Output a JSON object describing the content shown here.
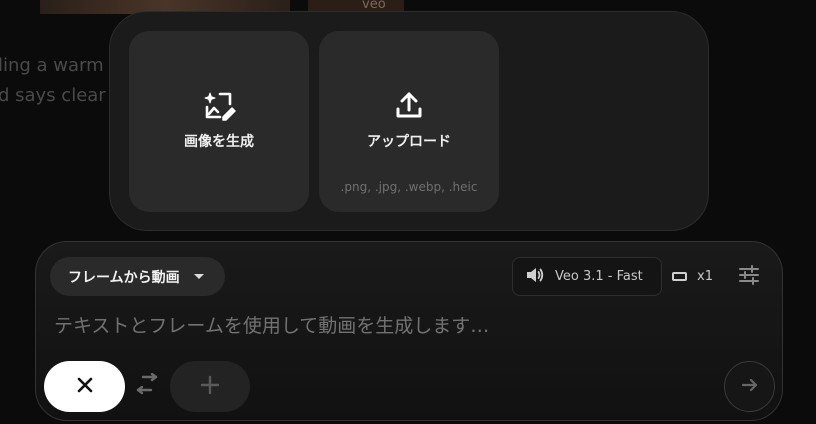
{
  "background": {
    "thumb_label": "veo",
    "text_line_1": "ling a warm c",
    "text_line_2": "d says clear"
  },
  "popup": {
    "generate_card": {
      "label": "画像を生成",
      "icon": "image-generate-icon"
    },
    "upload_card": {
      "label": "アップロード",
      "formats": ".png, .jpg, .webp, .heic",
      "icon": "upload-icon"
    }
  },
  "composer": {
    "mode_label": "フレームから動画",
    "model_label": "Veo 3.1 - Fast",
    "output_count": "x1",
    "prompt_placeholder": "テキストとフレームを使用して動画を生成します…",
    "icons": {
      "mode_caret": "caret-down-icon",
      "model": "speaker-icon",
      "ratio": "aspect-ratio-icon",
      "settings": "sliders-icon",
      "close": "close-icon",
      "swap": "swap-icon",
      "add": "plus-icon",
      "send": "arrow-right-icon"
    }
  },
  "colors": {
    "background": "#0b0b0b",
    "panel": "#1b1b1b",
    "card": "#2a2a2a",
    "close_button": "#ffffff"
  }
}
